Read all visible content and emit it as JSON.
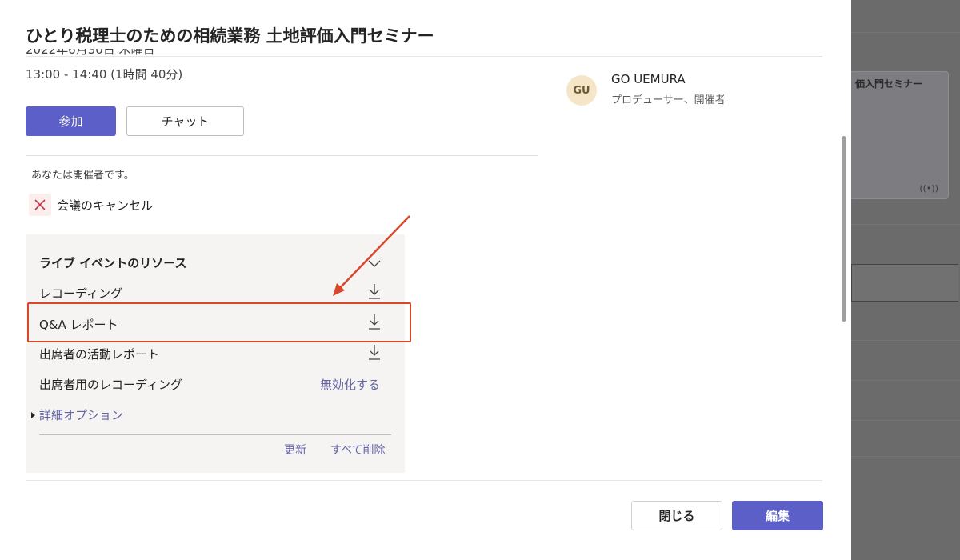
{
  "dialog": {
    "title": "ひとり税理士のための相続業務 土地評価入門セミナー",
    "date_clipped": "2022年6月30日 木曜日",
    "time": "13:00 - 14:40 (1時間 40分)",
    "join_label": "参加",
    "chat_label": "チャット",
    "organizer_note": "あなたは開催者です。",
    "cancel_label": "会議のキャンセル",
    "close_label": "閉じる",
    "edit_label": "編集"
  },
  "resources": {
    "title": "ライブ イベントのリソース",
    "items": [
      {
        "label": "レコーディング",
        "icon": "download-icon"
      },
      {
        "label": "Q&A レポート",
        "icon": "download-icon"
      },
      {
        "label": "出席者の活動レポート",
        "icon": "download-icon"
      }
    ],
    "attendee_recording_label": "出席者用のレコーディング",
    "disable_label": "無効化する",
    "advanced_options_label": "詳細オプション",
    "refresh_label": "更新",
    "delete_all_label": "すべて削除"
  },
  "person": {
    "initials": "GU",
    "name": "GO UEMURA",
    "role": "プロデューサー、開催者"
  },
  "background": {
    "card_title": "価入門セミナー"
  },
  "colors": {
    "accent": "#5b5fc7",
    "link": "#6264a7",
    "highlight": "#d9482b"
  }
}
